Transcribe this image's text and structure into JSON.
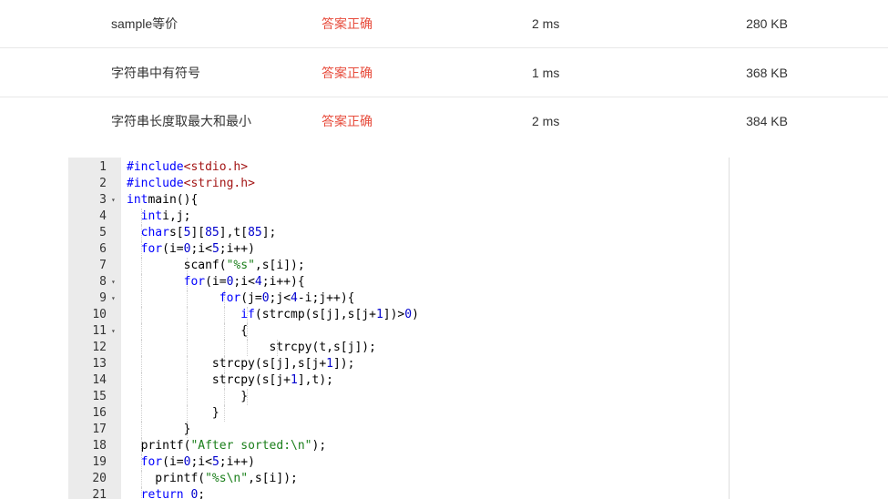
{
  "results": [
    {
      "name": "sample等价",
      "status": "答案正确",
      "time": "2 ms",
      "memory": "280 KB"
    },
    {
      "name": "字符串中有符号",
      "status": "答案正确",
      "time": "1 ms",
      "memory": "368 KB"
    },
    {
      "name": "字符串长度取最大和最小",
      "status": "答案正确",
      "time": "2 ms",
      "memory": "384 KB"
    }
  ],
  "code": {
    "line_numbers": [
      "1",
      "2",
      "3",
      "4",
      "5",
      "6",
      "7",
      "8",
      "9",
      "10",
      "11",
      "12",
      "13",
      "14",
      "15",
      "16",
      "17",
      "18",
      "19",
      "20",
      "21"
    ],
    "fold_marker": "▾"
  },
  "colors": {
    "status_ok": "#e74c3c",
    "keyword": "#0000ff",
    "string": "#1a7f1a",
    "include": "#a31515",
    "gutter": "#ebebeb"
  }
}
